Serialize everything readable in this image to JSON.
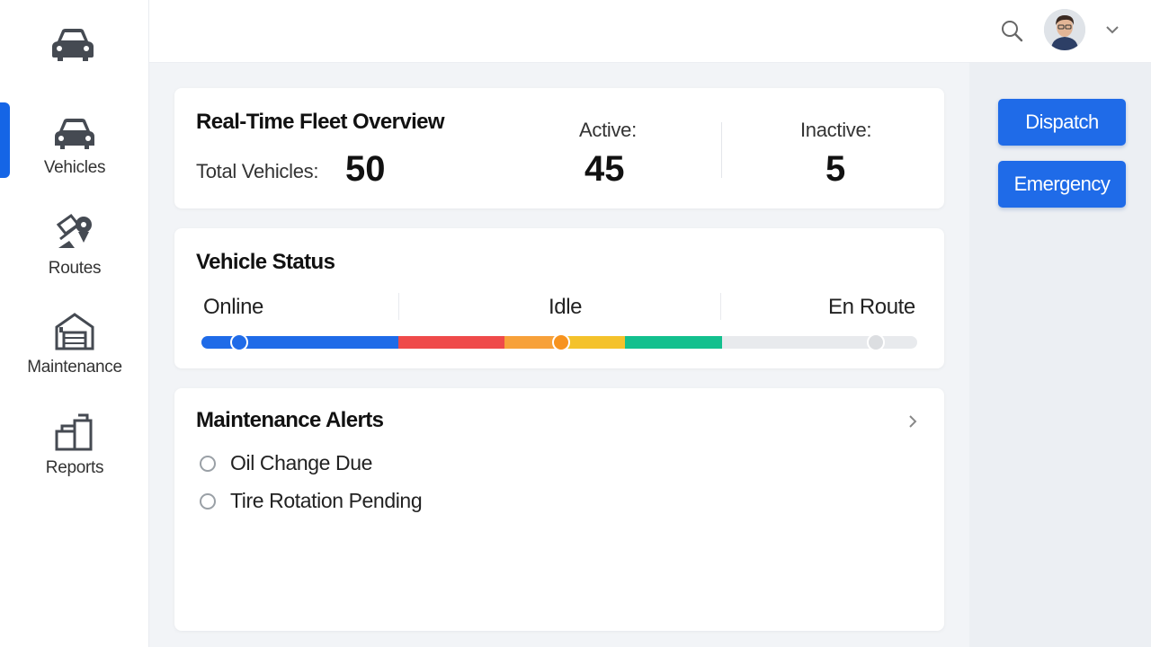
{
  "sidebar": {
    "items": [
      {
        "label": "Vehicles",
        "icon": "car-icon",
        "active": true
      },
      {
        "label": "Routes",
        "icon": "route-icon",
        "active": false
      },
      {
        "label": "Maintenance",
        "icon": "garage-icon",
        "active": false
      },
      {
        "label": "Reports",
        "icon": "reports-icon",
        "active": false
      }
    ],
    "logo_icon": "car-logo-icon"
  },
  "topbar": {
    "search_icon": "search-icon",
    "avatar": "user-avatar",
    "menu_icon": "chevron-down-icon"
  },
  "overview": {
    "title": "Real-Time Fleet Overview",
    "total_label": "Total Vehicles:",
    "total_value": "50",
    "active_label": "Active:",
    "active_value": "45",
    "inactive_label": "Inactive:",
    "inactive_value": "5"
  },
  "status": {
    "title": "Vehicle Status",
    "labels": [
      "Online",
      "Idle",
      "En Route"
    ],
    "segments": [
      {
        "color": "#1f6be8",
        "fraction": 0.275
      },
      {
        "color": "#ef4a4a",
        "fraction": 0.148
      },
      {
        "color": "#f7a13a",
        "fraction": 0.079
      },
      {
        "color": "#f4c22b",
        "fraction": 0.0
      },
      {
        "color": "#f4c22b",
        "fraction": 0.0
      },
      {
        "color": "#13c08e",
        "fraction": 0.0
      },
      {
        "color": "#e8eaed",
        "fraction": 0.0
      }
    ]
  },
  "alerts": {
    "title": "Maintenance Alerts",
    "items": [
      "Oil Change Due",
      "Tire Rotation Pending"
    ]
  },
  "actions": {
    "dispatch_label": "Dispatch",
    "emergency_label": "Emergency"
  },
  "colors": {
    "accent": "#1f6be8",
    "red": "#ef4a4a",
    "orange": "#f7a13a",
    "yellow": "#f4c22b",
    "green": "#13c08e"
  }
}
